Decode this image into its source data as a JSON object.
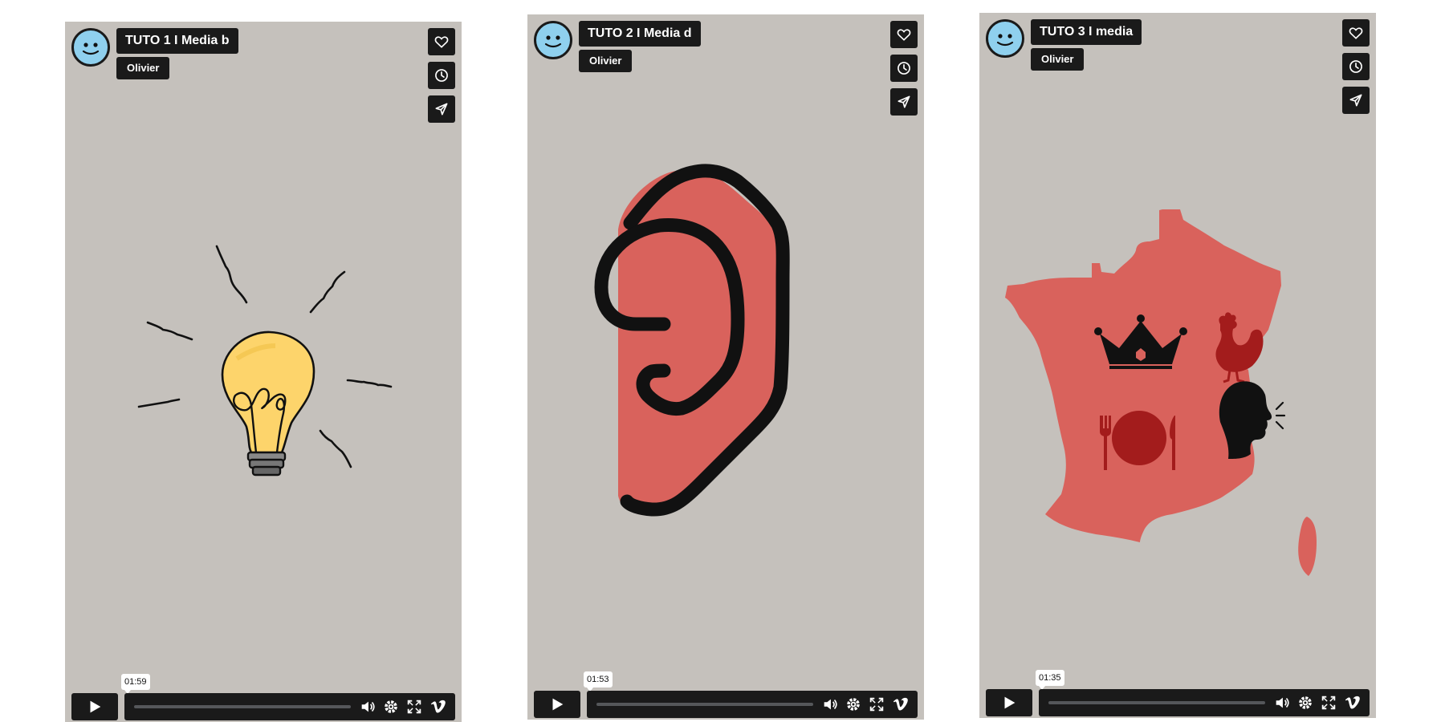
{
  "players": [
    {
      "title": "TUTO 1 I Media b",
      "author": "Olivier",
      "time": "01:59",
      "artwork": "lightbulb",
      "icons": [
        "heart-icon",
        "clock-icon",
        "send-icon",
        "play-icon",
        "volume-icon",
        "gear-icon",
        "fullscreen-icon",
        "vimeo-logo-icon"
      ]
    },
    {
      "title": "TUTO 2 I Media d",
      "author": "Olivier",
      "time": "01:53",
      "artwork": "ear",
      "icons": [
        "heart-icon",
        "clock-icon",
        "send-icon",
        "play-icon",
        "volume-icon",
        "gear-icon",
        "fullscreen-icon",
        "vimeo-logo-icon"
      ]
    },
    {
      "title": "TUTO 3 I media",
      "author": "Olivier",
      "time": "01:35",
      "artwork": "france-map",
      "icons": [
        "heart-icon",
        "clock-icon",
        "send-icon",
        "play-icon",
        "volume-icon",
        "gear-icon",
        "fullscreen-icon",
        "vimeo-logo-icon"
      ]
    }
  ],
  "colors": {
    "player_bg": "#c5c1bc",
    "controls_bg": "#1a1a1a",
    "accent_red": "#d9625c",
    "dark_red": "#a31c1c",
    "bulb_yellow": "#fdd46b",
    "avatar_blue": "#8fd0ee"
  }
}
